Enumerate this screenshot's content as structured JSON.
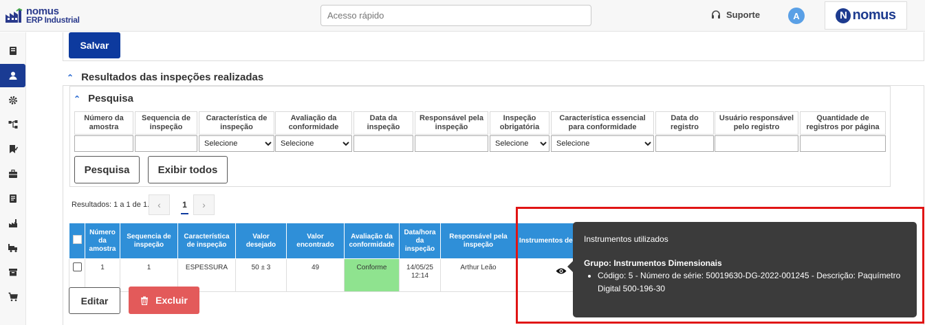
{
  "header": {
    "logo_line1": "nomus",
    "logo_line2": "ERP Industrial",
    "quick_access_placeholder": "Acesso rápido",
    "support_label": "Suporte",
    "avatar_initial": "A",
    "brand_letter": "N",
    "brand_text": "nomus"
  },
  "sidebar": {
    "items": [
      "book-icon",
      "user-icon",
      "gear-icon",
      "hierarchy-icon",
      "bookmark-icon",
      "briefcase-icon",
      "document-icon",
      "factory-icon",
      "truck-icon",
      "archive-icon",
      "cart-icon"
    ],
    "active_index": 1
  },
  "form": {
    "save_label": "Salvar"
  },
  "results_section": {
    "title": "Resultados das inspeções realizadas",
    "search_title": "Pesquisa",
    "filters": [
      {
        "label": "Número da amostra",
        "type": "text",
        "value": ""
      },
      {
        "label": "Sequencia de inspeção",
        "type": "text",
        "value": ""
      },
      {
        "label": "Característica de inspeção",
        "type": "select",
        "value": "Selecione"
      },
      {
        "label": "Avaliação da conformidade",
        "type": "select",
        "value": "Selecione"
      },
      {
        "label": "Data da inspeção",
        "type": "text",
        "value": ""
      },
      {
        "label": "Responsável pela inspeção",
        "type": "text",
        "value": ""
      },
      {
        "label": "Inspeção obrigatória",
        "type": "select",
        "value": "Selecione"
      },
      {
        "label": "Característica essencial para conformidade",
        "type": "select",
        "value": "Selecione"
      },
      {
        "label": "Data do registro",
        "type": "text",
        "value": ""
      },
      {
        "label": "Usuário responsável pelo registro",
        "type": "text",
        "value": ""
      },
      {
        "label": "Quantidade de registros por página",
        "type": "text",
        "value": ""
      }
    ],
    "search_button": "Pesquisa",
    "show_all_button": "Exibir todos",
    "results_info": "Resultados: 1 a 1 de 1.",
    "pagination": {
      "prev": "‹",
      "current": "1",
      "next": "›"
    },
    "table": {
      "columns": [
        "Número da amostra",
        "Sequencia de inspeção",
        "Característica de inspeção",
        "Valor desejado",
        "Valor encontrado",
        "Avaliação da conformidade",
        "Data/hora da inspeção",
        "Responsável pela inspeção",
        "Instrumentos de medição"
      ],
      "rows": [
        {
          "numero": "1",
          "sequencia": "1",
          "caracteristica": "ESPESSURA",
          "desejado": "50 ± 3",
          "encontrado": "49",
          "avaliacao": "Conforme",
          "data": "14/05/25",
          "hora": "12:14",
          "responsavel": "Arthur Leão"
        }
      ]
    },
    "edit_button": "Editar",
    "delete_button": "Excluir"
  },
  "tooltip": {
    "title": "Instrumentos utilizados",
    "group": "Grupo: Instrumentos Dimensionais",
    "items": [
      "Código: 5 - Número de série: 50019630-DG-2022-001245 - Descrição: Paquímetro Digital 500-196-30"
    ]
  },
  "colors": {
    "primary": "#0d3a9e",
    "table_header": "#2f8fd8",
    "conforme": "#8fe38f",
    "danger": "#e35a5a",
    "highlight": "#e01414"
  }
}
